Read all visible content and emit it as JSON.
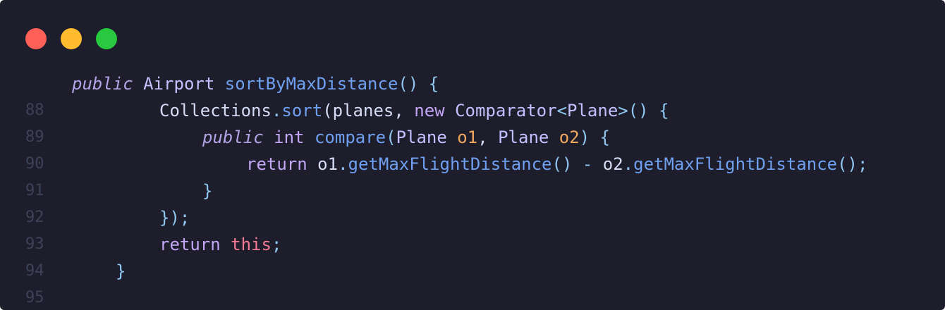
{
  "window": {
    "background": "#1d1d2b",
    "dots": [
      {
        "name": "close",
        "color": "#fe5f57"
      },
      {
        "name": "minimize",
        "color": "#febc2e"
      },
      {
        "name": "maximize",
        "color": "#28c840"
      }
    ]
  },
  "colors": {
    "line_number": "#3d4259",
    "keyword": "#c3a6f6",
    "function": "#6fa0f0",
    "parameter": "#f0a860",
    "this": "#f57a95"
  },
  "code": {
    "lines": [
      {
        "number": "88",
        "tokens": [
          {
            "text": "public",
            "kind": "kw-it"
          },
          {
            "text": " ",
            "kind": "ident"
          },
          {
            "text": "Airport",
            "kind": "type"
          },
          {
            "text": " ",
            "kind": "ident"
          },
          {
            "text": "sortByMaxDistance",
            "kind": "fn"
          },
          {
            "text": "() {",
            "kind": "punct"
          }
        ]
      },
      {
        "number": "89",
        "tokens": [
          {
            "text": "Collections",
            "kind": "ident"
          },
          {
            "text": ".",
            "kind": "punct"
          },
          {
            "text": "sort",
            "kind": "fn"
          },
          {
            "text": "(planes, ",
            "kind": "ident"
          },
          {
            "text": "new",
            "kind": "kw"
          },
          {
            "text": " ",
            "kind": "ident"
          },
          {
            "text": "Comparator",
            "kind": "type"
          },
          {
            "text": "<",
            "kind": "punct"
          },
          {
            "text": "Plane",
            "kind": "type"
          },
          {
            "text": ">",
            "kind": "punct"
          },
          {
            "text": "() {",
            "kind": "punct"
          }
        ]
      },
      {
        "number": "90",
        "tokens": [
          {
            "text": "public",
            "kind": "kw-it"
          },
          {
            "text": " ",
            "kind": "ident"
          },
          {
            "text": "int",
            "kind": "kw"
          },
          {
            "text": " ",
            "kind": "ident"
          },
          {
            "text": "compare",
            "kind": "fn"
          },
          {
            "text": "(",
            "kind": "punct"
          },
          {
            "text": "Plane",
            "kind": "type"
          },
          {
            "text": " ",
            "kind": "ident"
          },
          {
            "text": "o1",
            "kind": "param"
          },
          {
            "text": ", ",
            "kind": "ident"
          },
          {
            "text": "Plane",
            "kind": "type"
          },
          {
            "text": " ",
            "kind": "ident"
          },
          {
            "text": "o2",
            "kind": "param"
          },
          {
            "text": ") {",
            "kind": "punct"
          }
        ]
      },
      {
        "number": "91",
        "tokens": [
          {
            "text": "return",
            "kind": "kw"
          },
          {
            "text": " o1",
            "kind": "ident"
          },
          {
            "text": ".",
            "kind": "punct"
          },
          {
            "text": "getMaxFlightDistance",
            "kind": "fn"
          },
          {
            "text": "() ",
            "kind": "punct"
          },
          {
            "text": "-",
            "kind": "op"
          },
          {
            "text": " o2",
            "kind": "ident"
          },
          {
            "text": ".",
            "kind": "punct"
          },
          {
            "text": "getMaxFlightDistance",
            "kind": "fn"
          },
          {
            "text": "();",
            "kind": "punct"
          }
        ]
      },
      {
        "number": "92",
        "tokens": [
          {
            "text": "}",
            "kind": "punct"
          }
        ]
      },
      {
        "number": "93",
        "tokens": [
          {
            "text": "});",
            "kind": "punct"
          }
        ]
      },
      {
        "number": "94",
        "tokens": [
          {
            "text": "return",
            "kind": "kw"
          },
          {
            "text": " ",
            "kind": "ident"
          },
          {
            "text": "this",
            "kind": "this"
          },
          {
            "text": ";",
            "kind": "punct"
          }
        ]
      },
      {
        "number": "95",
        "tokens": [
          {
            "text": "}",
            "kind": "punct"
          }
        ]
      }
    ]
  }
}
